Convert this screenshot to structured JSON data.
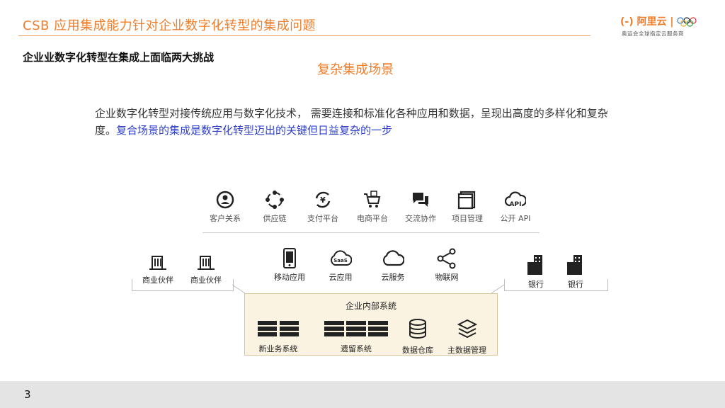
{
  "header": {
    "title": "CSB 应用集成能力针对企业数字化转型的集成问题",
    "logo_text": "(-) 阿里云 | ",
    "logo_sub": "奥运会全球指定云服务商"
  },
  "slide": {
    "subtitle": "企业业数字化转型在集成上面临两大挑战",
    "scene_title": "复杂集成场景",
    "para_part1": "企业数字化转型对接传统应用与数字化技术， 需要连接和标准化各种应用和数据，呈现出高度的多样化和复杂度。",
    "para_part2": "复合场景的集成是数字化转型迈出的关键但日益复杂的一步",
    "page_number": "3"
  },
  "top_row": [
    {
      "label": "客户关系",
      "icon": "customer-relation-icon"
    },
    {
      "label": "供应链",
      "icon": "supply-chain-icon"
    },
    {
      "label": "支付平台",
      "icon": "payment-icon"
    },
    {
      "label": "电商平台",
      "icon": "ecommerce-icon"
    },
    {
      "label": "交流协作",
      "icon": "chat-icon"
    },
    {
      "label": "项目管理",
      "icon": "project-icon"
    },
    {
      "label": "公开 API",
      "icon": "api-cloud-icon"
    }
  ],
  "middle_row": {
    "partners": [
      "商业伙伴",
      "商业伙伴"
    ],
    "center": [
      {
        "label": "移动应用",
        "icon": "mobile-icon"
      },
      {
        "label": "云应用",
        "icon": "saas-icon"
      },
      {
        "label": "云服务",
        "icon": "cloud-icon"
      },
      {
        "label": "物联网",
        "icon": "iot-icon"
      }
    ],
    "banks": [
      "银行",
      "银行"
    ]
  },
  "internal": {
    "title": "企业内部系统",
    "items": [
      {
        "label": "新业务系统",
        "icon": "new-system-icon"
      },
      {
        "label": "遗留系统",
        "icon": "legacy-system-icon"
      },
      {
        "label": "数据仓库",
        "icon": "database-icon"
      },
      {
        "label": "主数据管理",
        "icon": "layers-icon"
      }
    ]
  },
  "colors": {
    "accent": "#f07d2a",
    "highlight": "#2f3fc8",
    "box_fill": "#fbf3e1"
  }
}
